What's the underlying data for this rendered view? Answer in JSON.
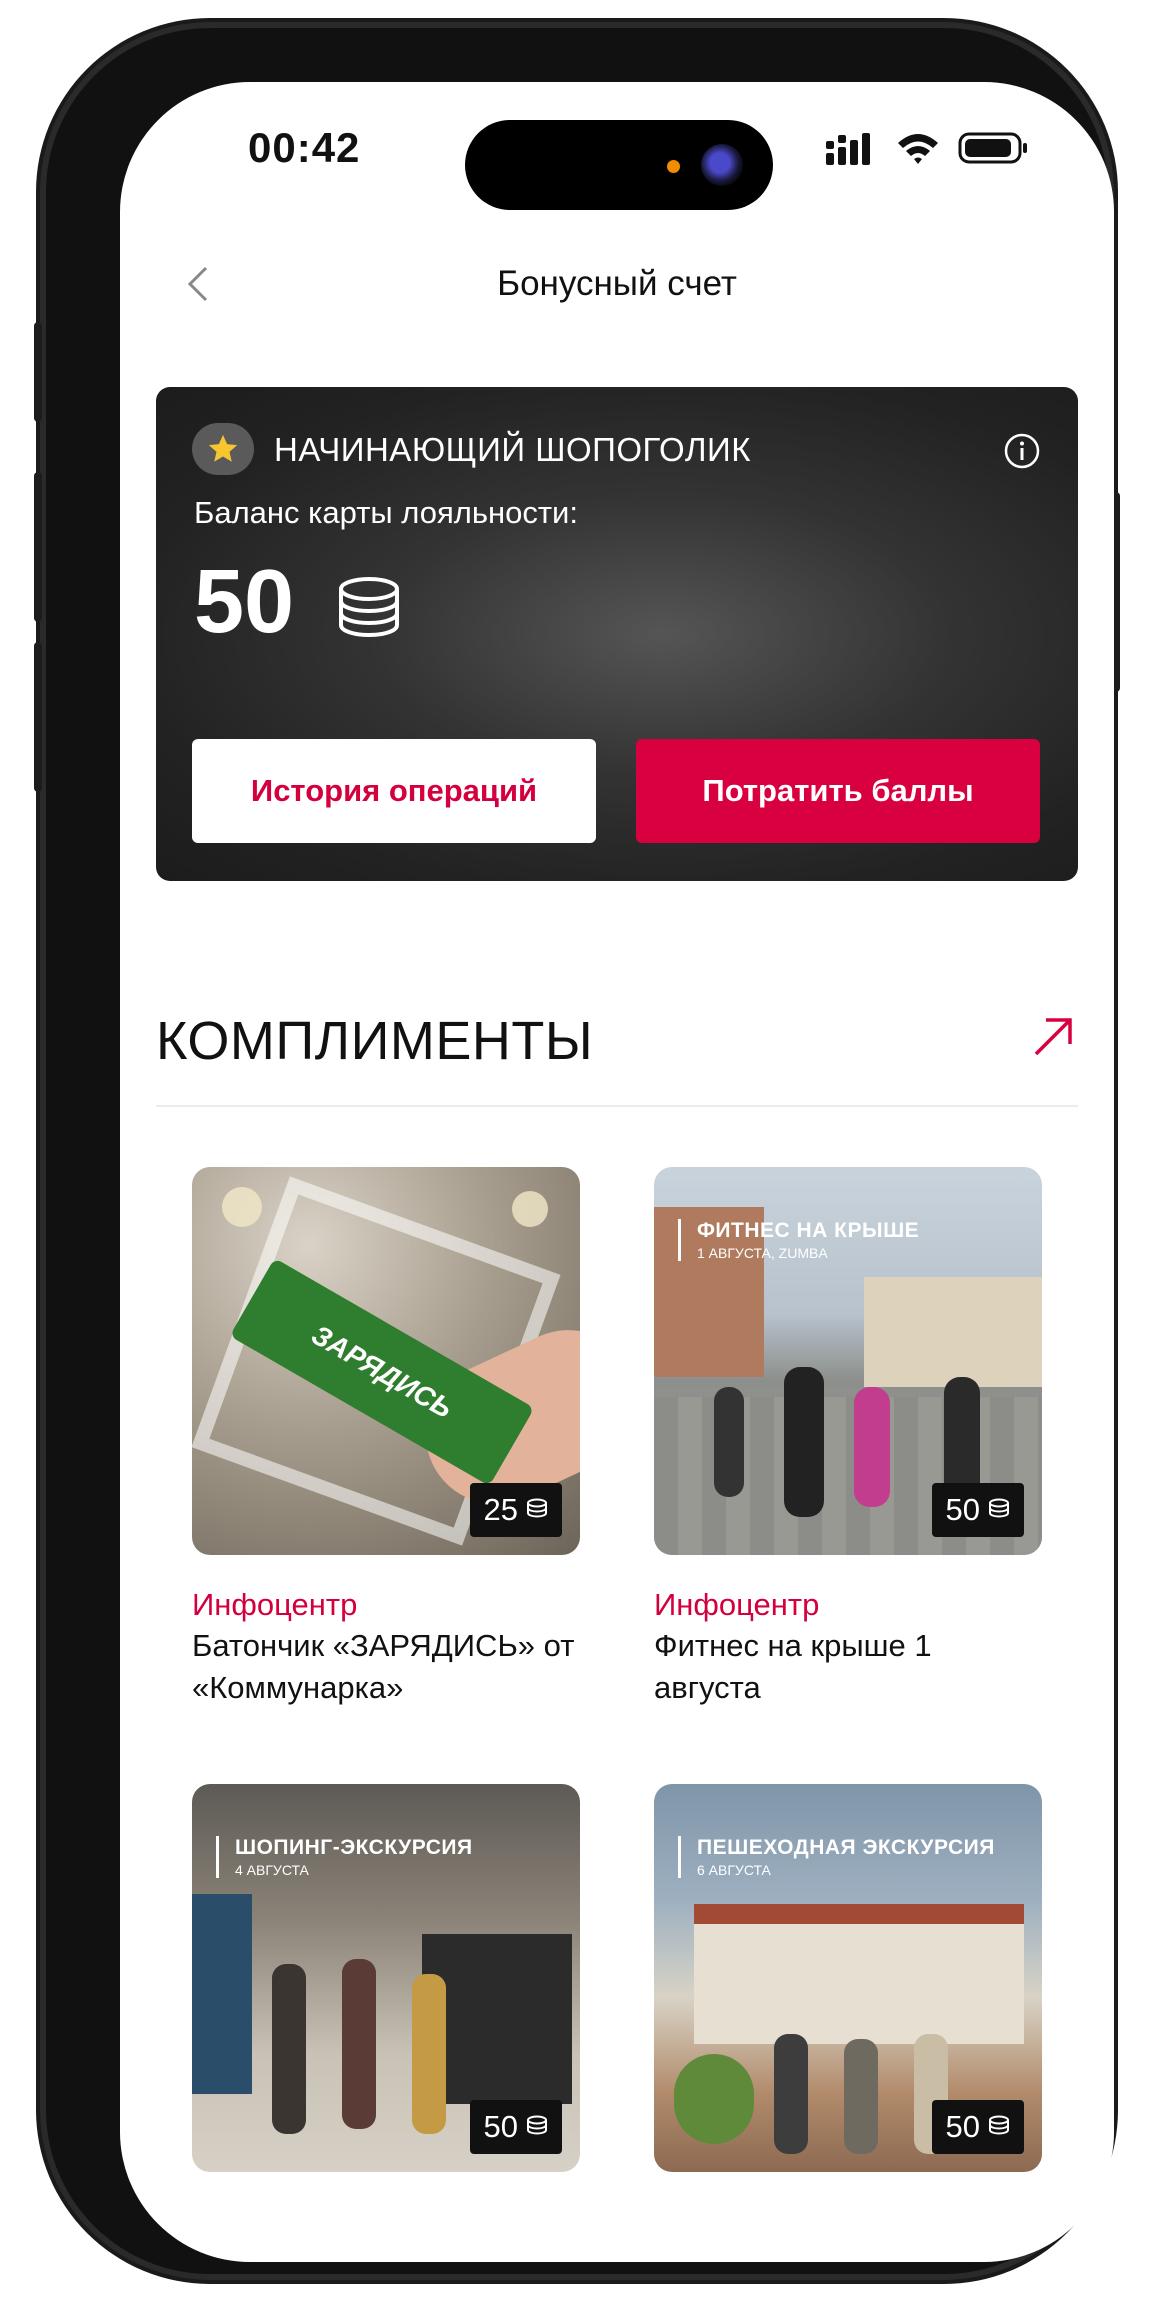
{
  "status_bar": {
    "time": "00:42"
  },
  "nav": {
    "title": "Бонусный счет"
  },
  "loyalty_card": {
    "level": "НАЧИНАЮЩИЙ ШОПОГОЛИК",
    "balance_label": "Баланс карты лояльности:",
    "balance": "50",
    "history_button": "История операций",
    "spend_button": "Потратить баллы"
  },
  "compliments": {
    "title": "КОМПЛИМЕНТЫ",
    "items": [
      {
        "category": "Инфоцентр",
        "name": "Батончик «ЗАРЯДИСЬ» от «Коммунарка»",
        "price": "25",
        "image_text": "ЗАРЯДИСЬ"
      },
      {
        "category": "Инфоцентр",
        "name": "Фитнес на крыше 1 августа",
        "price": "50",
        "overlay_title": "ФИТНЕС НА КРЫШЕ",
        "overlay_sub": "1 АВГУСТА, ZUMBA"
      },
      {
        "price": "50",
        "overlay_title": "ШОПИНГ-ЭКСКУРСИЯ",
        "overlay_sub": "4 АВГУСТА"
      },
      {
        "price": "50",
        "overlay_title": "ПЕШЕХОДНАЯ ЭКСКУРСИЯ",
        "overlay_sub": "6 АВГУСТА"
      }
    ]
  },
  "colors": {
    "accent": "#d9003f",
    "card_dark": "#222222",
    "text": "#111111"
  }
}
